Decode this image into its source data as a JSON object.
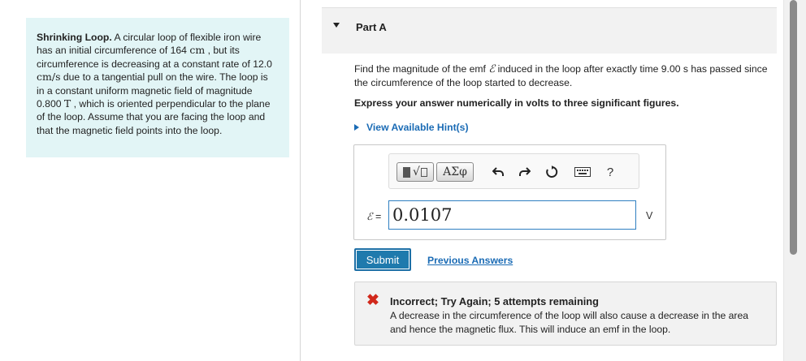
{
  "problem": {
    "title": "Shrinking Loop.",
    "text_1": " A circular loop of flexible iron wire has an initial circumference of 164 ",
    "unit_cm": "cm",
    "text_2": " , but its circumference is decreasing at a constant rate of ",
    "rate_value": "12.0 ",
    "unit_rate": "cm/s",
    "text_3": " due to a tangential pull on the wire. The loop is in a constant uniform magnetic field of magnitude 0.800 ",
    "unit_T": "T",
    "text_4": " , which is oriented perpendicular to the plane of the loop. Assume that you are facing the loop and that the magnetic field points into the loop."
  },
  "part": {
    "title": "Part A",
    "question_1": "Find the magnitude of the emf ",
    "emf_symbol": "ℰ",
    "question_2": " induced in the loop after exactly time 9.00 s has passed since the circumference of the loop started to decrease.",
    "instructions": "Express your answer numerically in volts to three significant figures.",
    "hints_label": "View Available Hint(s)"
  },
  "toolbar": {
    "template_btn": "√▯",
    "greek_btn": "ΑΣφ",
    "help_label": "?"
  },
  "answer": {
    "symbol": "ℰ",
    "equals": " =",
    "value": "0.0107",
    "unit": "V"
  },
  "actions": {
    "submit_label": "Submit",
    "previous_label": "Previous Answers"
  },
  "feedback": {
    "icon": "✖",
    "title": "Incorrect; Try Again; 5 attempts remaining",
    "message": "A decrease in the circumference of the loop will also cause a decrease in the area and hence the magnetic flux. This will induce an emf in the loop."
  },
  "colors": {
    "problem_bg": "#e2f5f6",
    "link": "#1a6bb5",
    "submit_bg": "#1f7aad",
    "error": "#d1281b"
  }
}
